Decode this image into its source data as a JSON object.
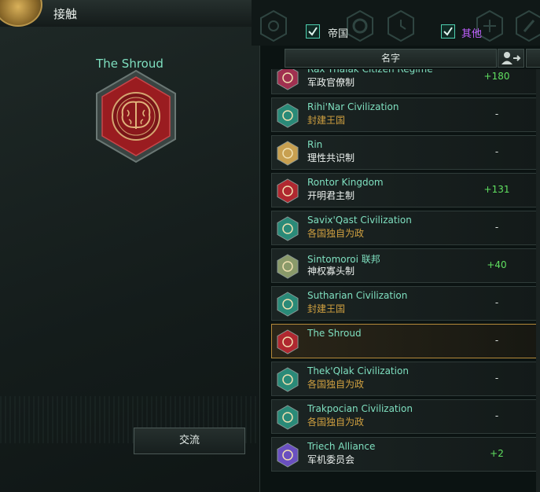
{
  "window": {
    "title": "接触"
  },
  "selected_empire": {
    "name": "The Shroud",
    "icon": "brain-icon"
  },
  "buttons": {
    "communicate": "交流"
  },
  "filters": {
    "empires": {
      "label": "帝国",
      "checked": true
    },
    "others": {
      "label": "其他",
      "checked": true
    }
  },
  "table": {
    "column_name": "名字",
    "column_icon": "add-contact-icon"
  },
  "colors": {
    "accent": "#7fe0c0",
    "positive": "#60e060",
    "others_label": "#c060ff",
    "selected_border": "#b58a3a"
  },
  "contacts": [
    {
      "name": "Rax'Thalak Citizen Regime",
      "government": "军政官僚制",
      "opinion": "+180",
      "icon": "claw-icon",
      "icon_color": "#a03050"
    },
    {
      "name": "Rihi'Nar Civilization",
      "government": "封建王国",
      "opinion": "-",
      "icon": "axe-icon",
      "icon_color": "#2a8a78"
    },
    {
      "name": "Rin",
      "government": "理性共识制",
      "opinion": "-",
      "icon": "cog-icon",
      "icon_color": "#c8a050"
    },
    {
      "name": "Rontor Kingdom",
      "government": "开明君主制",
      "opinion": "+131",
      "icon": "crescent-icon",
      "icon_color": "#b02830"
    },
    {
      "name": "Savix'Qast Civilization",
      "government": "各国独自为政",
      "opinion": "-",
      "icon": "hook-icon",
      "icon_color": "#2a8a78"
    },
    {
      "name": "Sintomoroi 联邦",
      "government": "神权寡头制",
      "opinion": "+40",
      "icon": "eye-icon",
      "icon_color": "#8a9a6a"
    },
    {
      "name": "Sutharian Civilization",
      "government": "封建王国",
      "opinion": "-",
      "icon": "axe-icon",
      "icon_color": "#2a8a78"
    },
    {
      "name": "The Shroud",
      "government": "",
      "opinion": "-",
      "icon": "brain-icon",
      "icon_color": "#b02830"
    },
    {
      "name": "Thek'Qlak Civilization",
      "government": "各国独自为政",
      "opinion": "-",
      "icon": "hook-icon",
      "icon_color": "#2a8a78"
    },
    {
      "name": "Trakpocian Civilization",
      "government": "各国独自为政",
      "opinion": "-",
      "icon": "hook-icon",
      "icon_color": "#2a8a78"
    },
    {
      "name": "Triech Alliance",
      "government": "军机委员会",
      "opinion": "+2",
      "icon": "star-icon",
      "icon_color": "#6a50c0"
    }
  ]
}
